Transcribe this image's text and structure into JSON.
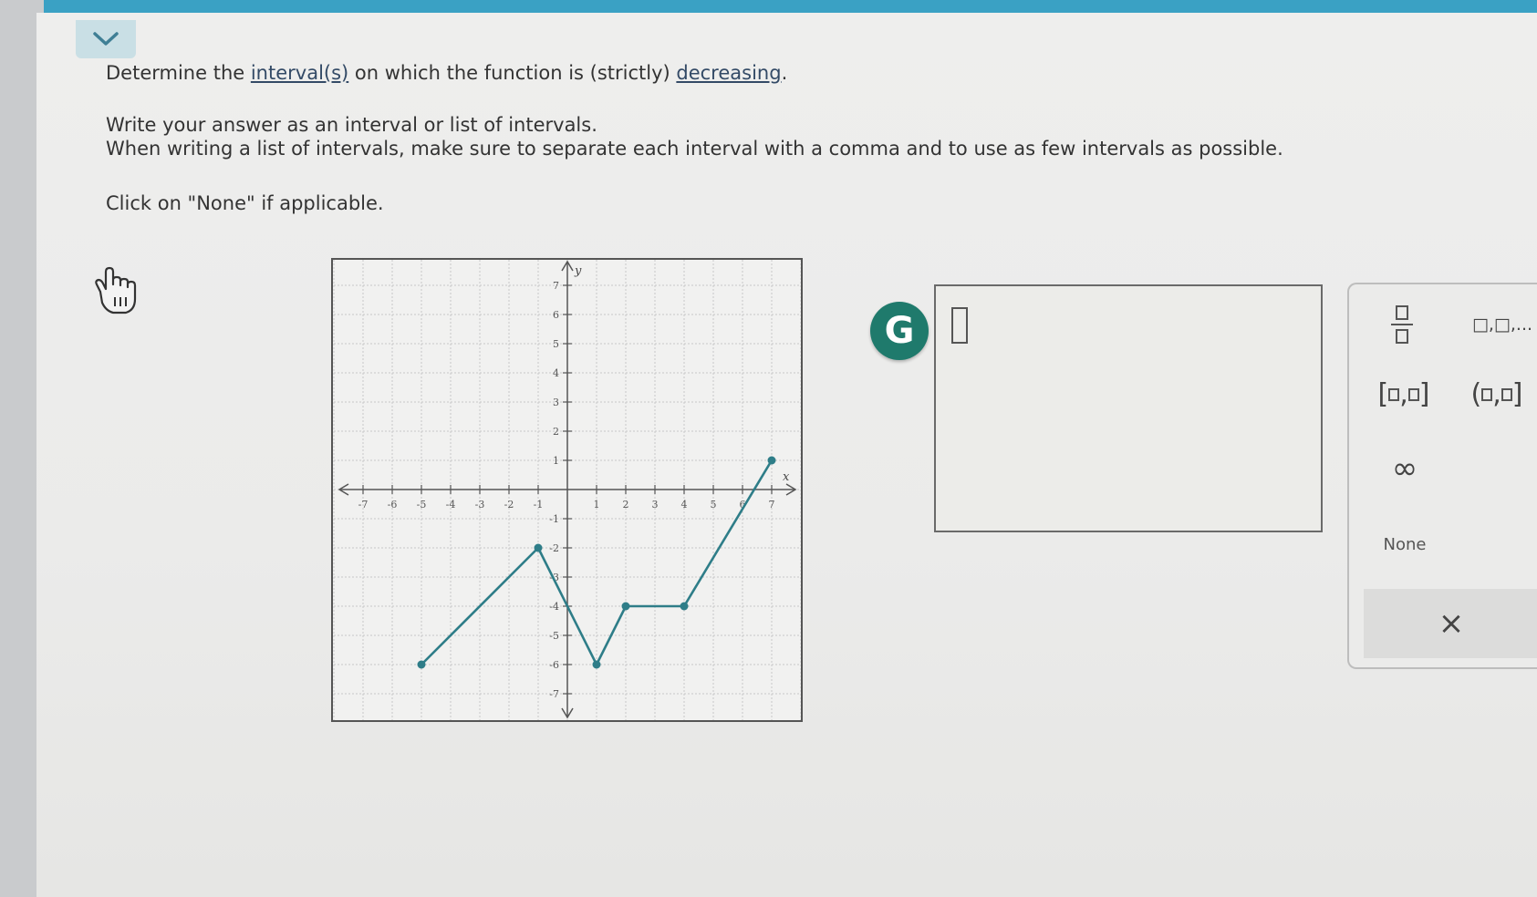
{
  "question": {
    "line1_prefix": "Determine the ",
    "line1_link1": "interval(s)",
    "line1_middle": " on which the function is (strictly) ",
    "line1_link2": "decreasing",
    "line1_suffix": ".",
    "line2": "Write your answer as an interval or list of intervals.",
    "line3": "When writing a list of intervals, make sure to separate each interval with a comma and to use as few intervals as possible.",
    "line4": "Click on \"None\" if applicable."
  },
  "graph": {
    "x_axis_label": "x",
    "y_axis_label": "y",
    "x_range": [
      -8,
      8
    ],
    "y_range": [
      -8,
      8
    ],
    "x_ticks": [
      "-7",
      "-6",
      "-5",
      "-4",
      "-3",
      "-2",
      "-1",
      "1",
      "2",
      "3",
      "4",
      "5",
      "6",
      "7"
    ],
    "y_ticks": [
      "7",
      "6",
      "5",
      "4",
      "3",
      "2",
      "1",
      "-1",
      "-2",
      "-3",
      "-4",
      "-5",
      "-6",
      "-7"
    ],
    "line_color": "#2e7d88",
    "points": [
      {
        "x": -5,
        "y": -6
      },
      {
        "x": -1,
        "y": -2
      },
      {
        "x": 1,
        "y": -6
      },
      {
        "x": 2,
        "y": -4
      },
      {
        "x": 4,
        "y": -4
      },
      {
        "x": 7,
        "y": 1
      }
    ],
    "closed_dots": [
      {
        "x": -5,
        "y": -6
      },
      {
        "x": -1,
        "y": -2
      },
      {
        "x": 1,
        "y": -6
      },
      {
        "x": 2,
        "y": -4
      },
      {
        "x": 4,
        "y": -4
      },
      {
        "x": 7,
        "y": 1
      }
    ]
  },
  "tools": {
    "g_button_label": "G",
    "list_label": "□,□,...",
    "infinity_label": "∞",
    "none_label": "None",
    "clear_label": "×"
  },
  "colors": {
    "top_bar": "#3aa1c4",
    "g_button": "#1f7a6c",
    "tab": "#c9dfe5"
  },
  "icons": {
    "collapse": "chevron-down-icon",
    "hand": "pointer-hand-icon"
  }
}
